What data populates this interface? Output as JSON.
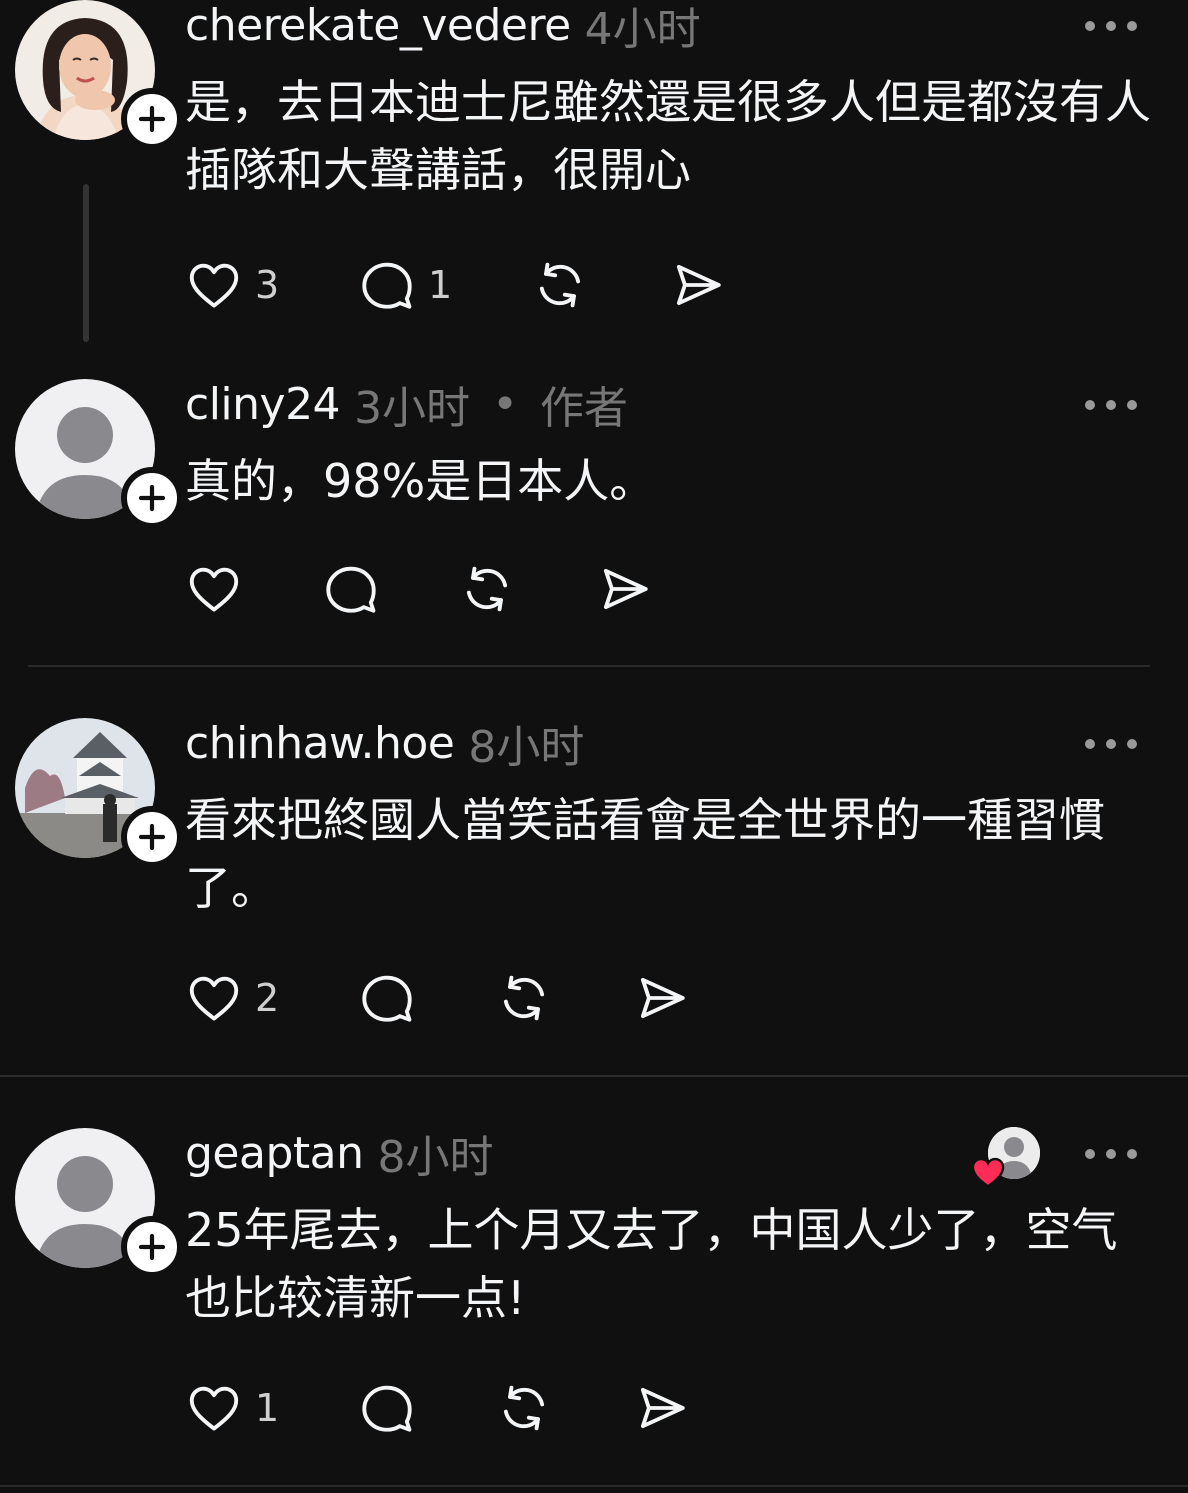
{
  "posts": [
    {
      "username": "cherekate_vedere",
      "time": "4小时",
      "text": "是，去日本迪士尼雖然還是很多人但是都沒有人插隊和大聲講話，很開心",
      "likes": "3",
      "replies": "1",
      "avatar": "photo-woman"
    },
    {
      "username": "cliny24",
      "time": "3小时",
      "author_dot": "•",
      "author_badge": "作者",
      "text": "真的，98%是日本人。",
      "likes": "",
      "replies": "",
      "avatar": "default-person"
    },
    {
      "username": "chinhaw.hoe",
      "time": "8小时",
      "text": "看來把終國人當笑話看會是全世界的一種習慣了。",
      "likes": "2",
      "replies": "",
      "avatar": "photo-castle"
    },
    {
      "username": "geaptan",
      "time": "8小时",
      "text": "25年尾去，上个月又去了，中国人少了，空气也比较清新一点!",
      "likes": "1",
      "replies": "",
      "avatar": "default-person",
      "liked_by_author": true
    }
  ],
  "icons": {
    "like": "heart-icon",
    "reply": "comment-icon",
    "repost": "repost-icon",
    "share": "send-icon",
    "more": "more-dots-icon",
    "follow": "plus-icon"
  },
  "colors": {
    "background": "#101010",
    "text": "#f3f5f7",
    "muted": "#777777",
    "heart_red": "#ff2d55"
  }
}
